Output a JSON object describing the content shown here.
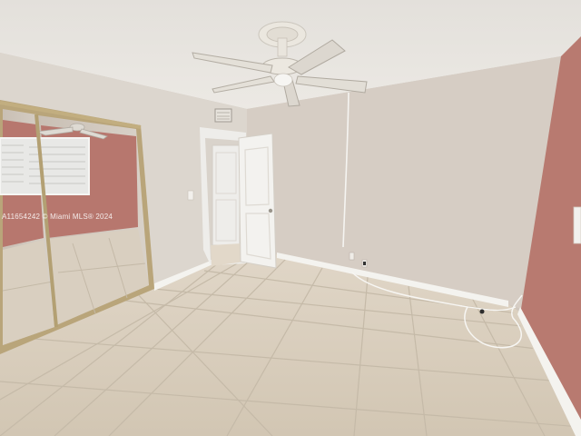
{
  "photo": {
    "watermark": "A11654242 © Miami MLS® 2024"
  },
  "colors": {
    "ceiling": "#e9e6e1",
    "back_wall": "#d7cec5",
    "left_wall": "#dcd6ce",
    "accent_wall": "#b87a70",
    "floor_tile": "#d8cdbd",
    "grout": "#c3b8a6",
    "door": "#f3f2ef",
    "mirror_frame": "#b9a57a",
    "baseboard": "#f4f3ef"
  }
}
